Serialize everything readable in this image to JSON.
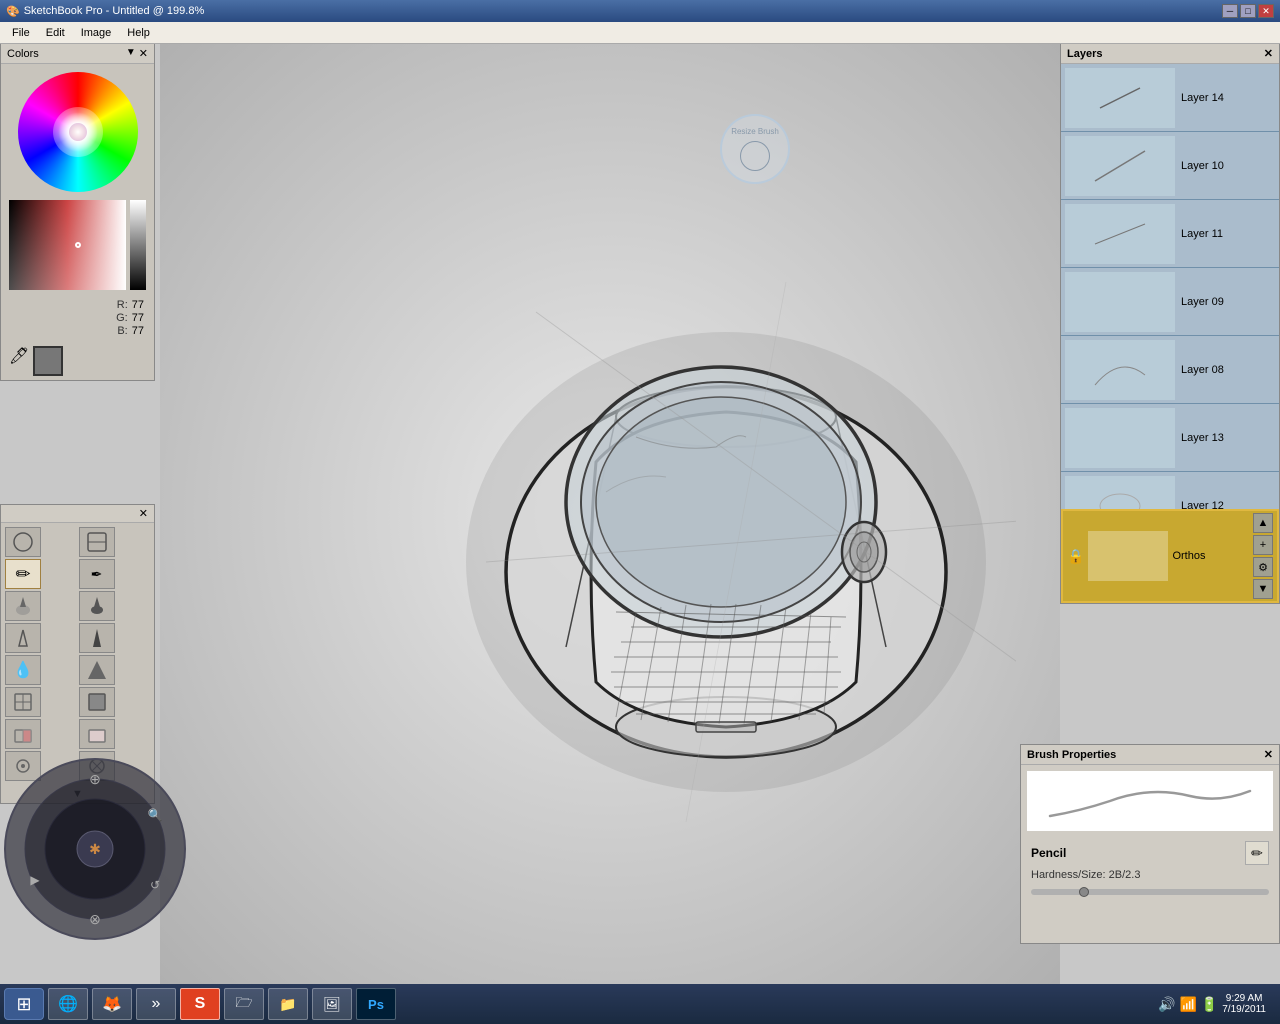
{
  "titleBar": {
    "title": "SketchBook Pro - Untitled @ 199.8%",
    "controls": [
      "minimize",
      "maximize",
      "close"
    ]
  },
  "menuBar": {
    "items": [
      "File",
      "Edit",
      "Image",
      "Help"
    ]
  },
  "colors": {
    "title": "Colors",
    "r": "77",
    "g": "77",
    "b": "77",
    "colorValue": "#4d4d4d"
  },
  "brushPanel": {
    "brushes": [
      {
        "name": "circle-brush",
        "icon": "○"
      },
      {
        "name": "smear-brush",
        "icon": "⬡"
      },
      {
        "name": "pencil-brush",
        "icon": "✏"
      },
      {
        "name": "marker-brush",
        "icon": "✒"
      },
      {
        "name": "soft-brush",
        "icon": "◐"
      },
      {
        "name": "hard-brush",
        "icon": "◑"
      },
      {
        "name": "airbrush",
        "icon": "△"
      },
      {
        "name": "ink-brush",
        "icon": "▲"
      },
      {
        "name": "smudge-brush",
        "icon": "◈"
      },
      {
        "name": "blur-brush",
        "icon": "⊕"
      },
      {
        "name": "water-brush",
        "icon": "◇"
      },
      {
        "name": "rough-brush",
        "icon": "◆"
      },
      {
        "name": "erase-soft",
        "icon": "□"
      },
      {
        "name": "erase-hard",
        "icon": "■"
      },
      {
        "name": "lasso",
        "icon": "⊙"
      },
      {
        "name": "magic-wand",
        "icon": "⊗"
      }
    ],
    "scrollDown": "▼"
  },
  "layers": {
    "title": "Layers",
    "items": [
      {
        "name": "Layer 14",
        "icon": "✏",
        "active": false
      },
      {
        "name": "Layer 10",
        "icon": "✏",
        "active": false
      },
      {
        "name": "Layer 11",
        "icon": "✏",
        "active": false
      },
      {
        "name": "Layer 09",
        "icon": "✏",
        "active": false
      },
      {
        "name": "Layer 08",
        "icon": "✏",
        "active": false
      },
      {
        "name": "Layer 13",
        "icon": "✏",
        "active": false
      },
      {
        "name": "Layer 12",
        "icon": "✏",
        "active": false
      },
      {
        "name": "Orthos",
        "icon": "⊙",
        "active": true
      }
    ]
  },
  "brushProperties": {
    "title": "Brush Properties",
    "brushName": "Pencil",
    "hardness": "Hardness/Size: 2B/2.3",
    "pencilIcon": "✏"
  },
  "brushIndicator": {
    "label": "Resize Brush"
  },
  "taskbar": {
    "time": "9:29 AM",
    "date": "7/19/2011",
    "apps": [
      {
        "name": "start",
        "icon": "⊞"
      },
      {
        "name": "ie",
        "icon": "🌐"
      },
      {
        "name": "firefox",
        "icon": "🦊"
      },
      {
        "name": "sbp",
        "icon": "S"
      },
      {
        "name": "folder",
        "icon": "📁"
      },
      {
        "name": "windows",
        "icon": "⊞"
      },
      {
        "name": "photos",
        "icon": "🖼"
      },
      {
        "name": "photoshop",
        "icon": "Ps"
      }
    ]
  }
}
